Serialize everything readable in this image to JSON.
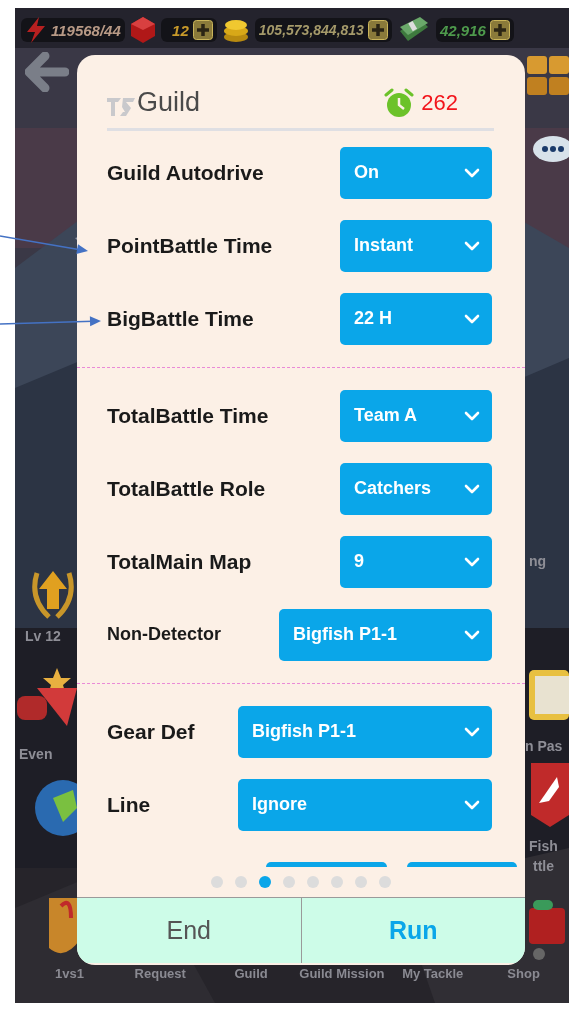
{
  "top_bar": {
    "energy": "119568/44",
    "gems": "12",
    "coins": "105,573,844,813",
    "cash": "42,916"
  },
  "side_labels": [
    {
      "text": "Lv 12",
      "kind": "level"
    },
    {
      "text": "Even",
      "kind": "event"
    },
    {
      "text": "ng",
      "kind": "ranking"
    },
    {
      "text": "n Pas",
      "kind": "pass"
    },
    {
      "text": "Fish",
      "kind": "fish"
    },
    {
      "text": "ttle",
      "kind": "fish_line2"
    }
  ],
  "bottom_nav": [
    "1vs1",
    "Request",
    "Guild",
    "Guild Mission",
    "My Tackle",
    "Shop"
  ],
  "dialog": {
    "title": "Guild",
    "timer": "262",
    "sections": [
      [
        {
          "label": "Guild Autodrive",
          "value": "On",
          "kind": "normal"
        },
        {
          "label": "PointBattle Time",
          "value": "Instant",
          "kind": "normal"
        },
        {
          "label": "BigBattle Time",
          "value": "22 H",
          "kind": "normal"
        }
      ],
      [
        {
          "label": "TotalBattle Time",
          "value": "Team A",
          "kind": "normal"
        },
        {
          "label": "TotalBattle Role",
          "value": "Catchers",
          "kind": "normal"
        },
        {
          "label": "TotalMain Map",
          "value": "9",
          "kind": "normal"
        },
        {
          "label": "Non-Detector",
          "value": "Bigfish P1-1",
          "kind": "wide"
        }
      ],
      [
        {
          "label": "Gear Def",
          "value": "Bigfish P1-1",
          "kind": "full"
        },
        {
          "label": "Line",
          "value": "Ignore",
          "kind": "full"
        },
        {
          "kind": "pair"
        }
      ]
    ],
    "pages": [
      {
        "selected": false
      },
      {
        "selected": false
      },
      {
        "selected": true
      },
      {
        "selected": false
      },
      {
        "selected": false
      },
      {
        "selected": false
      },
      {
        "selected": false
      },
      {
        "selected": false
      }
    ],
    "buttons": [
      {
        "label": "End",
        "kind": "secondary"
      },
      {
        "label": "Run",
        "kind": "primary"
      }
    ]
  },
  "annotations": [
    {
      "kind": "arrow"
    },
    {
      "kind": "arrow"
    }
  ]
}
